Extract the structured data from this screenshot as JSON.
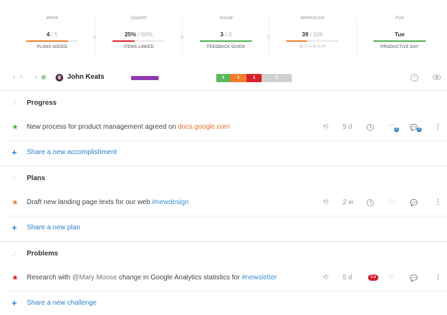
{
  "stats": [
    {
      "label": "Week",
      "value": "4",
      "total": "5",
      "caption": "PLANS ADDED",
      "progress": 0.8,
      "color": "#f57b2c"
    },
    {
      "label": "Quarter",
      "value": "25%",
      "total": "60%",
      "caption": "ITEMS LINKED",
      "progress": 0.42,
      "color": "#d8222b"
    },
    {
      "label": "Social",
      "value": "3",
      "total": "3",
      "caption": "FEEDBACK GIVEN",
      "progress": 1.0,
      "color": "#4cb050"
    },
    {
      "label": "Weekscore",
      "value": "39",
      "total": "100",
      "caption": "",
      "progress": 0.39,
      "color": "#f57b2c",
      "dots": "ⒽⒾⒿⓀⓁⓂ"
    },
    {
      "label": "Fun",
      "value": "Tue",
      "total": "",
      "caption": "PRODUCTIVE DAY",
      "progress": 1.0,
      "color": "#4cb050"
    }
  ],
  "operators": {
    "plus1": "+",
    "plus2": "+",
    "equals": "="
  },
  "user": {
    "name": "John Keats",
    "bar_color": "#8e3ab0",
    "status_counts": [
      {
        "value": "1",
        "color": "#5cb85c"
      },
      {
        "value": "1",
        "color": "#f57b2c"
      },
      {
        "value": "1",
        "color": "#d8222b"
      },
      {
        "value": "3",
        "color": "#d0d0d0"
      }
    ],
    "nav": {
      "chev1": "›",
      "x": "x",
      "chev2": "›",
      "dot": "?"
    }
  },
  "sections": [
    {
      "title": "Progress",
      "item": {
        "star_color": "#4cb050",
        "text": "New process for product management agreed on ",
        "link": "docs.google.com",
        "age": "5 d",
        "likes": "1",
        "comments": "1"
      },
      "add_label": "Share a new accomplishment"
    },
    {
      "title": "Plans",
      "item": {
        "star_color": "#f57b2c",
        "text": "Draft new landing page texts for our web ",
        "tag": "#newdesign",
        "age": "2 w"
      },
      "add_label": "Share a new plan"
    },
    {
      "title": "Problems",
      "item": {
        "star_color": "#d8222b",
        "pre": "Research with ",
        "mention": "@Mary Moose",
        "mid": " change in Google Analytics statistics for ",
        "tag": "#newsletter",
        "age": "5 d",
        "badge": "2 d"
      },
      "add_label": "Share a new challenge"
    }
  ],
  "icons": {
    "pin": "⟋",
    "star": "★",
    "plus": "+",
    "cycle": "⟲",
    "heart": "♡",
    "bubble": "💬",
    "kebab": "⋮"
  }
}
